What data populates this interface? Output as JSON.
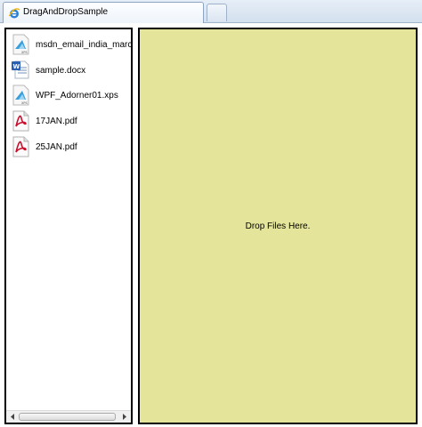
{
  "window": {
    "tab_title": "DragAndDropSample"
  },
  "file_list": {
    "items": [
      {
        "name": "msdn_email_india_march",
        "icon": "xps-document-icon"
      },
      {
        "name": "sample.docx",
        "icon": "word-document-icon"
      },
      {
        "name": "WPF_Adorner01.xps",
        "icon": "xps-document-icon"
      },
      {
        "name": "17JAN.pdf",
        "icon": "pdf-document-icon"
      },
      {
        "name": "25JAN.pdf",
        "icon": "pdf-document-icon"
      }
    ]
  },
  "drop_zone": {
    "text": "Drop Files Here."
  },
  "colors": {
    "drop_zone_background": "#e4e59b",
    "pdf_red": "#c8102e"
  }
}
